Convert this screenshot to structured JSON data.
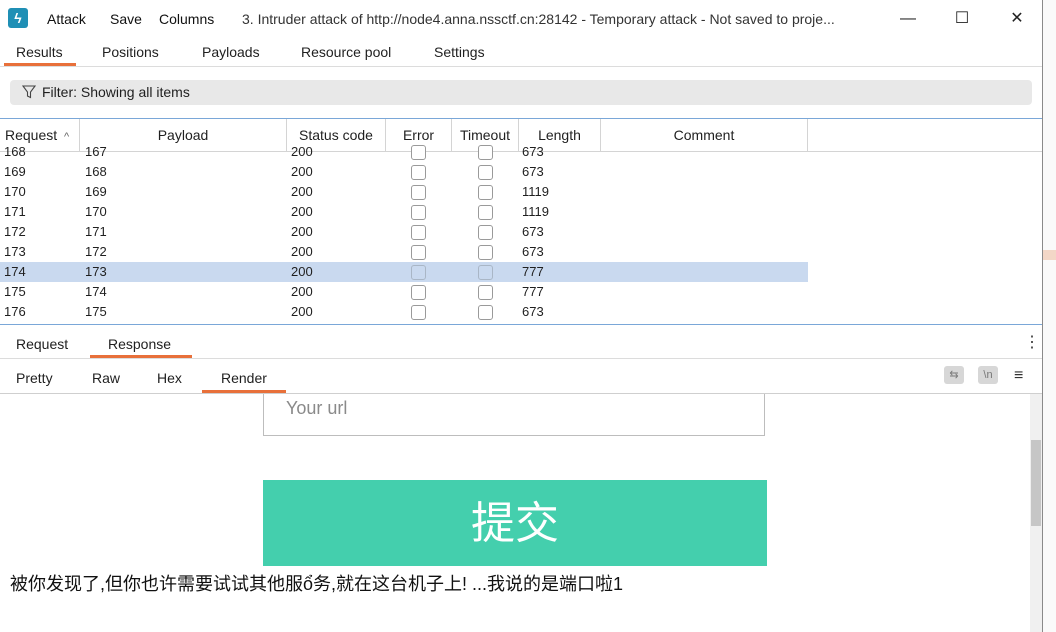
{
  "window": {
    "title": "3. Intruder attack of http://node4.anna.nssctf.cn:28142 - Temporary attack - Not saved to proje...",
    "menu": [
      "Attack",
      "Save",
      "Columns"
    ],
    "app_icon_glyph": "ϟ",
    "controls": {
      "minimize": "—",
      "maximize": "☐",
      "close": "✕"
    }
  },
  "main_tabs": [
    "Results",
    "Positions",
    "Payloads",
    "Resource pool",
    "Settings"
  ],
  "filter": {
    "text": "Filter: Showing all items"
  },
  "table": {
    "columns": [
      "Request",
      "Payload",
      "Status code",
      "Error",
      "Timeout",
      "Length",
      "Comment"
    ],
    "sort_indicator": "^",
    "rows": [
      {
        "request": "168",
        "payload": "167",
        "status": "200",
        "length": "673"
      },
      {
        "request": "169",
        "payload": "168",
        "status": "200",
        "length": "673"
      },
      {
        "request": "170",
        "payload": "169",
        "status": "200",
        "length": "1119"
      },
      {
        "request": "171",
        "payload": "170",
        "status": "200",
        "length": "1119"
      },
      {
        "request": "172",
        "payload": "171",
        "status": "200",
        "length": "673"
      },
      {
        "request": "173",
        "payload": "172",
        "status": "200",
        "length": "673"
      },
      {
        "request": "174",
        "payload": "173",
        "status": "200",
        "length": "777"
      },
      {
        "request": "175",
        "payload": "174",
        "status": "200",
        "length": "777"
      },
      {
        "request": "176",
        "payload": "175",
        "status": "200",
        "length": "673"
      }
    ],
    "selected_request": "174"
  },
  "detail_tabs": [
    "Request",
    "Response"
  ],
  "view_tabs": [
    "Pretty",
    "Raw",
    "Hex",
    "Render"
  ],
  "view_tools": {
    "wrap_glyph": "⇆",
    "newline_glyph": "\\n",
    "menu_glyph": "≡",
    "kebab_glyph": "⋮"
  },
  "render": {
    "url_placeholder": "Your url",
    "submit_label": "提交",
    "message": "被你发现了,但你也许需要试试其他服ổ务,就在这台机子上! ...我说的是端口啦1"
  },
  "colors": {
    "accent": "#e8703a",
    "selection": "#c9d9ef",
    "submit_bg": "#44cfad"
  }
}
